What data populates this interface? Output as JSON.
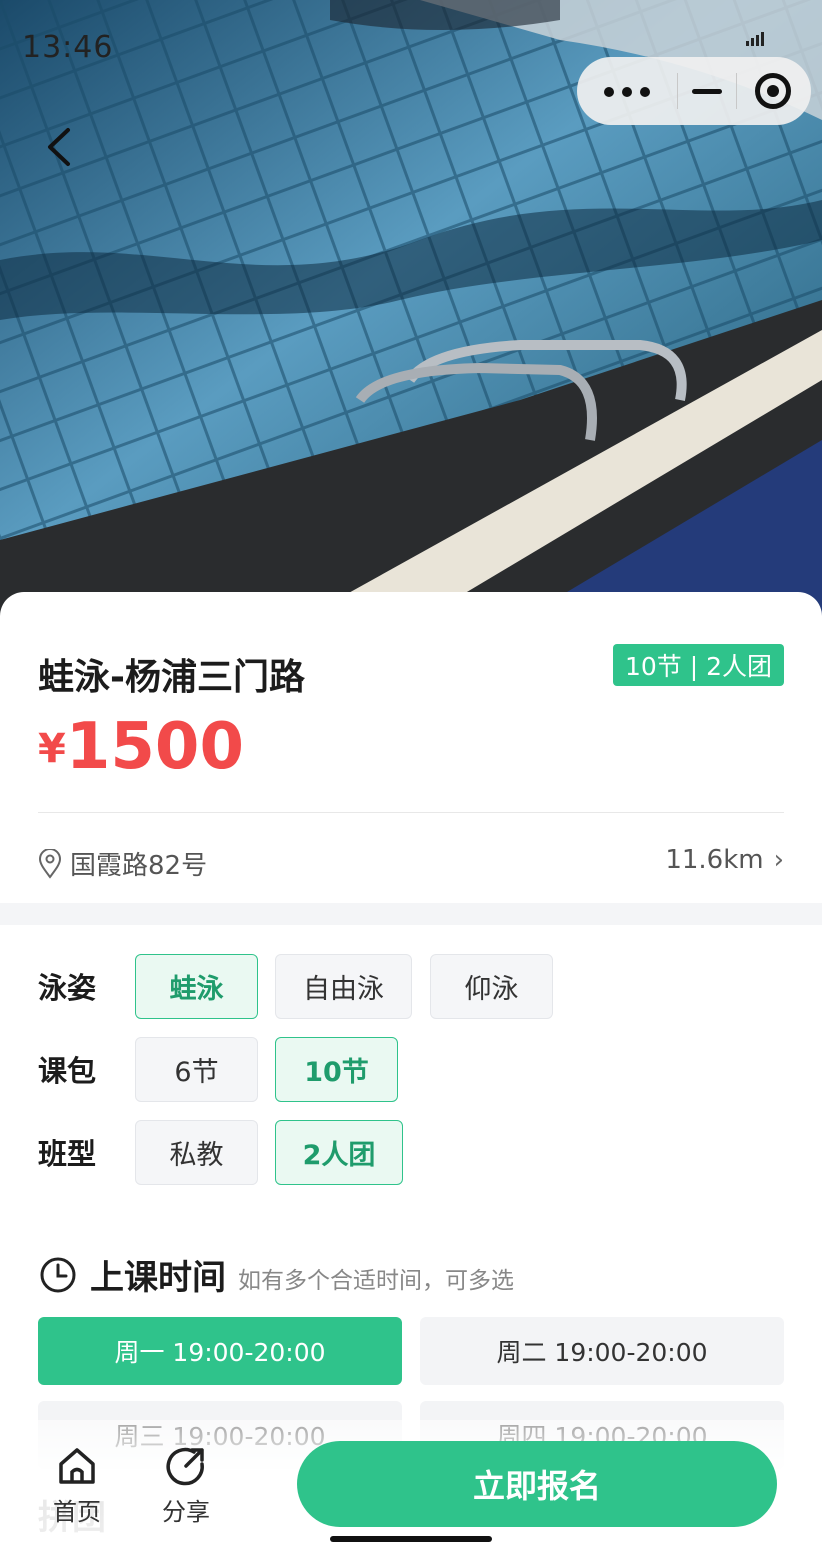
{
  "status": {
    "time": "13:46"
  },
  "course": {
    "title": "蛙泳-杨浦三门路",
    "badge": "10节 | 2人团",
    "currency": "¥",
    "price": "1500",
    "address": "国霞路82号",
    "distance": "11.6km"
  },
  "options": {
    "stroke": {
      "label": "泳姿",
      "items": [
        "蛙泳",
        "自由泳",
        "仰泳"
      ],
      "selected": "蛙泳"
    },
    "package": {
      "label": "课包",
      "items": [
        "6节",
        "10节"
      ],
      "selected": "10节"
    },
    "class_type": {
      "label": "班型",
      "items": [
        "私教",
        "2人团"
      ],
      "selected": "2人团"
    }
  },
  "schedule": {
    "title": "上课时间",
    "hint": "如有多个合适时间，可多选",
    "slots": [
      "周一 19:00-20:00",
      "周二 19:00-20:00",
      "周三 19:00-20:00",
      "周四 19:00-20:00"
    ],
    "selected": "周一 19:00-20:00"
  },
  "next_section": {
    "title": "拼团"
  },
  "bottom_bar": {
    "home_label": "首页",
    "share_label": "分享",
    "cta_label": "立即报名"
  },
  "colors": {
    "accent": "#2fc38b",
    "price": "#f24a4a"
  },
  "icons": [
    "back-arrow-icon",
    "more-dots-icon",
    "minimize-icon",
    "close-target-icon",
    "location-pin-icon",
    "clock-icon",
    "home-icon",
    "share-icon",
    "signal-icon"
  ]
}
